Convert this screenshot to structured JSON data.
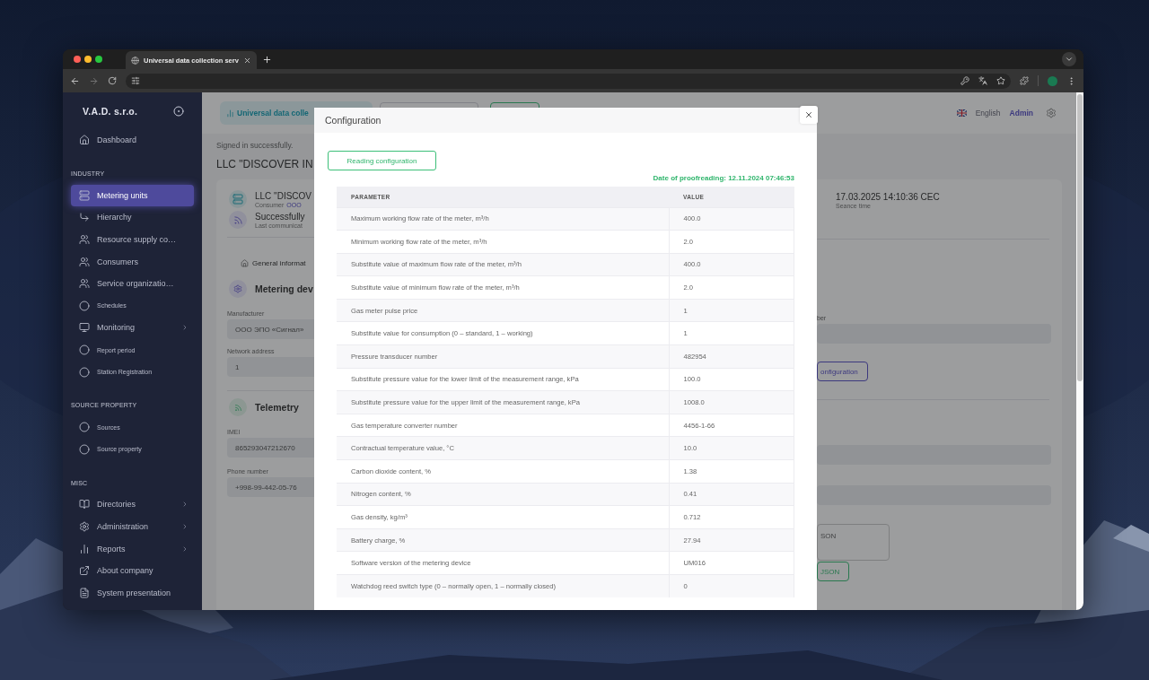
{
  "browser": {
    "tab_title": "Universal data collection serv"
  },
  "sidebar": {
    "brand": "V.A.D. s.r.o.",
    "items": [
      {
        "kind": "link",
        "label": "Dashboard",
        "selected": false,
        "expandable": false
      },
      {
        "kind": "heading",
        "label": "INDUSTRY"
      },
      {
        "kind": "link",
        "label": "Metering units",
        "selected": true,
        "expandable": false
      },
      {
        "kind": "link",
        "label": "Hierarchy",
        "selected": false,
        "expandable": false
      },
      {
        "kind": "link",
        "label": "Resource supply co…",
        "selected": false,
        "expandable": false
      },
      {
        "kind": "link",
        "label": "Consumers",
        "selected": false,
        "expandable": false
      },
      {
        "kind": "link",
        "label": "Service organizatio…",
        "selected": false,
        "expandable": false
      },
      {
        "kind": "dot",
        "label": "Schedules",
        "selected": false,
        "expandable": false
      },
      {
        "kind": "link",
        "label": "Monitoring",
        "selected": false,
        "expandable": true
      },
      {
        "kind": "dot",
        "label": "Report period",
        "selected": false,
        "expandable": false
      },
      {
        "kind": "dot",
        "label": "Station Registration",
        "selected": false,
        "expandable": false
      },
      {
        "kind": "heading",
        "label": "SOURCE PROPERTY"
      },
      {
        "kind": "dot",
        "label": "Sources",
        "selected": false,
        "expandable": false
      },
      {
        "kind": "dot",
        "label": "Source property",
        "selected": false,
        "expandable": false
      },
      {
        "kind": "heading",
        "label": "MISC"
      },
      {
        "kind": "link",
        "label": "Directories",
        "selected": false,
        "expandable": true
      },
      {
        "kind": "link",
        "label": "Administration",
        "selected": false,
        "expandable": true
      },
      {
        "kind": "link",
        "label": "Reports",
        "selected": false,
        "expandable": true
      },
      {
        "kind": "link",
        "label": "About company",
        "selected": false,
        "expandable": false
      },
      {
        "kind": "link",
        "label": "System presentation",
        "selected": false,
        "expandable": false
      }
    ]
  },
  "header": {
    "app_button": "Universal data colle",
    "language": "English",
    "user": "Admin"
  },
  "notice": "Signed in successfully.",
  "page_title": "LLC \"DISCOVER IN",
  "summary": {
    "name": "LLC \"DISCOV",
    "consumer_label": "Consumer",
    "consumer_link": "ООО",
    "status": "Successfully",
    "status_note": "Last communicat",
    "session_time": "17.03.2025 14:10:36 CEC",
    "session_label": "Seance time"
  },
  "tabs": [
    {
      "label": "General informat",
      "selected": true
    }
  ],
  "device": {
    "title": "Metering dev",
    "fields": [
      {
        "label": "Manufacturer",
        "value": "ООО ЭПО «Сигнал»"
      },
      {
        "label": "Network address",
        "value": "1"
      }
    ],
    "right_label": "ber",
    "config_button": "onfiguration"
  },
  "telemetry": {
    "title": "Telemetry",
    "fields": [
      {
        "label": "IMEI",
        "value": "865293047212670"
      },
      {
        "label": "Phone number",
        "value": "+998-99-442-05-76"
      }
    ],
    "json_placeholder": "SON",
    "json_button": "JSON"
  },
  "modal": {
    "title": "Configuration",
    "read_button": "Reading configuration",
    "proofread_date": "Date of proofreading: 12.11.2024 07:46:53",
    "columns": [
      "PARAMETER",
      "VALUE"
    ],
    "rows": [
      [
        "Maximum working flow rate of the meter, m³/h",
        "400.0"
      ],
      [
        "Minimum working flow rate of the meter, m³/h",
        "2.0"
      ],
      [
        "Substitute value of maximum flow rate of the meter, m³/h",
        "400.0"
      ],
      [
        "Substitute value of minimum flow rate of the meter, m³/h",
        "2.0"
      ],
      [
        "Gas meter pulse price",
        "1"
      ],
      [
        "Substitute value for consumption (0 – standard, 1 – working)",
        "1"
      ],
      [
        "Pressure transducer number",
        "482954"
      ],
      [
        "Substitute pressure value for the lower limit of the measurement range, kPa",
        "100.0"
      ],
      [
        "Substitute pressure value for the upper limit of the measurement range, kPa",
        "1008.0"
      ],
      [
        "Gas temperature converter number",
        "4456-1-66"
      ],
      [
        "Contractual temperature value, °C",
        "10.0"
      ],
      [
        "Carbon dioxide content, %",
        "1.38"
      ],
      [
        "Nitrogen content, %",
        "0.41"
      ],
      [
        "Gas density, kg/m³",
        "0.712"
      ],
      [
        "Battery charge, %",
        "27.94"
      ],
      [
        "Software version of the metering device",
        "UM016"
      ],
      [
        "Watchdog reed switch type (0 – normally open, 1 – normally closed)",
        "0"
      ]
    ]
  }
}
